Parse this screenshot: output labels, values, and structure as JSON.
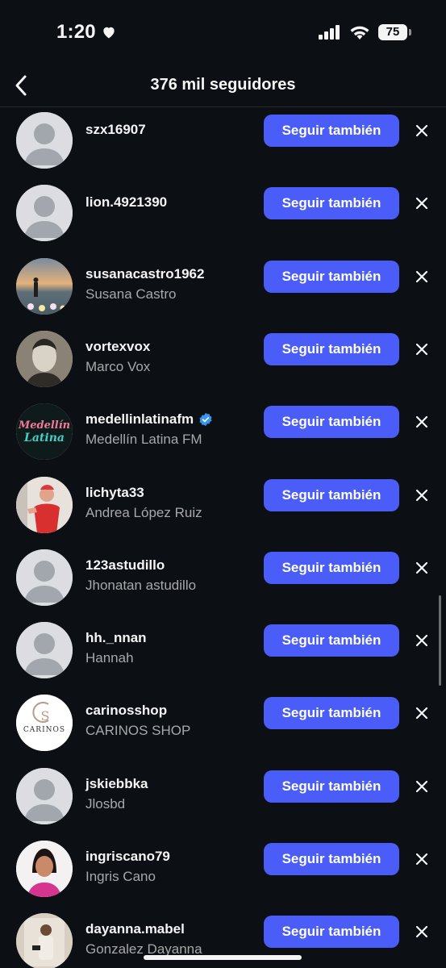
{
  "status_bar": {
    "time": "1:20",
    "battery": "75"
  },
  "header": {
    "title": "376 mil seguidores"
  },
  "follow_label": "Seguir también",
  "followers": [
    {
      "username": "szx16907",
      "fullname": "",
      "avatar": "default"
    },
    {
      "username": "lion.4921390",
      "fullname": "",
      "avatar": "default"
    },
    {
      "username": "susanacastro1962",
      "fullname": "Susana Castro",
      "avatar": "beach"
    },
    {
      "username": "vortexvox",
      "fullname": "Marco Vox",
      "avatar": "portrait-bw"
    },
    {
      "username": "medellinlatinafm",
      "fullname": "Medellín Latina FM",
      "avatar": "logo",
      "verified": true,
      "logo_text": "Medellín",
      "logo_text2": "Latina"
    },
    {
      "username": "lichyta33",
      "fullname": "Andrea López Ruiz",
      "avatar": "red-dress"
    },
    {
      "username": "123astudillo",
      "fullname": "Jhonatan astudillo",
      "avatar": "default"
    },
    {
      "username": "hh._nnan",
      "fullname": "Hannah",
      "avatar": "default"
    },
    {
      "username": "carinosshop",
      "fullname": "CARINOS SHOP",
      "avatar": "carinos",
      "logo_text": "CARINOS"
    },
    {
      "username": "jskiebbka",
      "fullname": "Jlosbd",
      "avatar": "default"
    },
    {
      "username": "ingriscano79",
      "fullname": "Ingris Cano",
      "avatar": "woman"
    },
    {
      "username": "dayanna.mabel",
      "fullname": "Gonzalez Dayanna",
      "avatar": "mirror"
    }
  ],
  "colors": {
    "background": "#0c1014",
    "button": "#4a5df9",
    "secondary_text": "#a8a8a8",
    "verified": "#3797f0"
  }
}
